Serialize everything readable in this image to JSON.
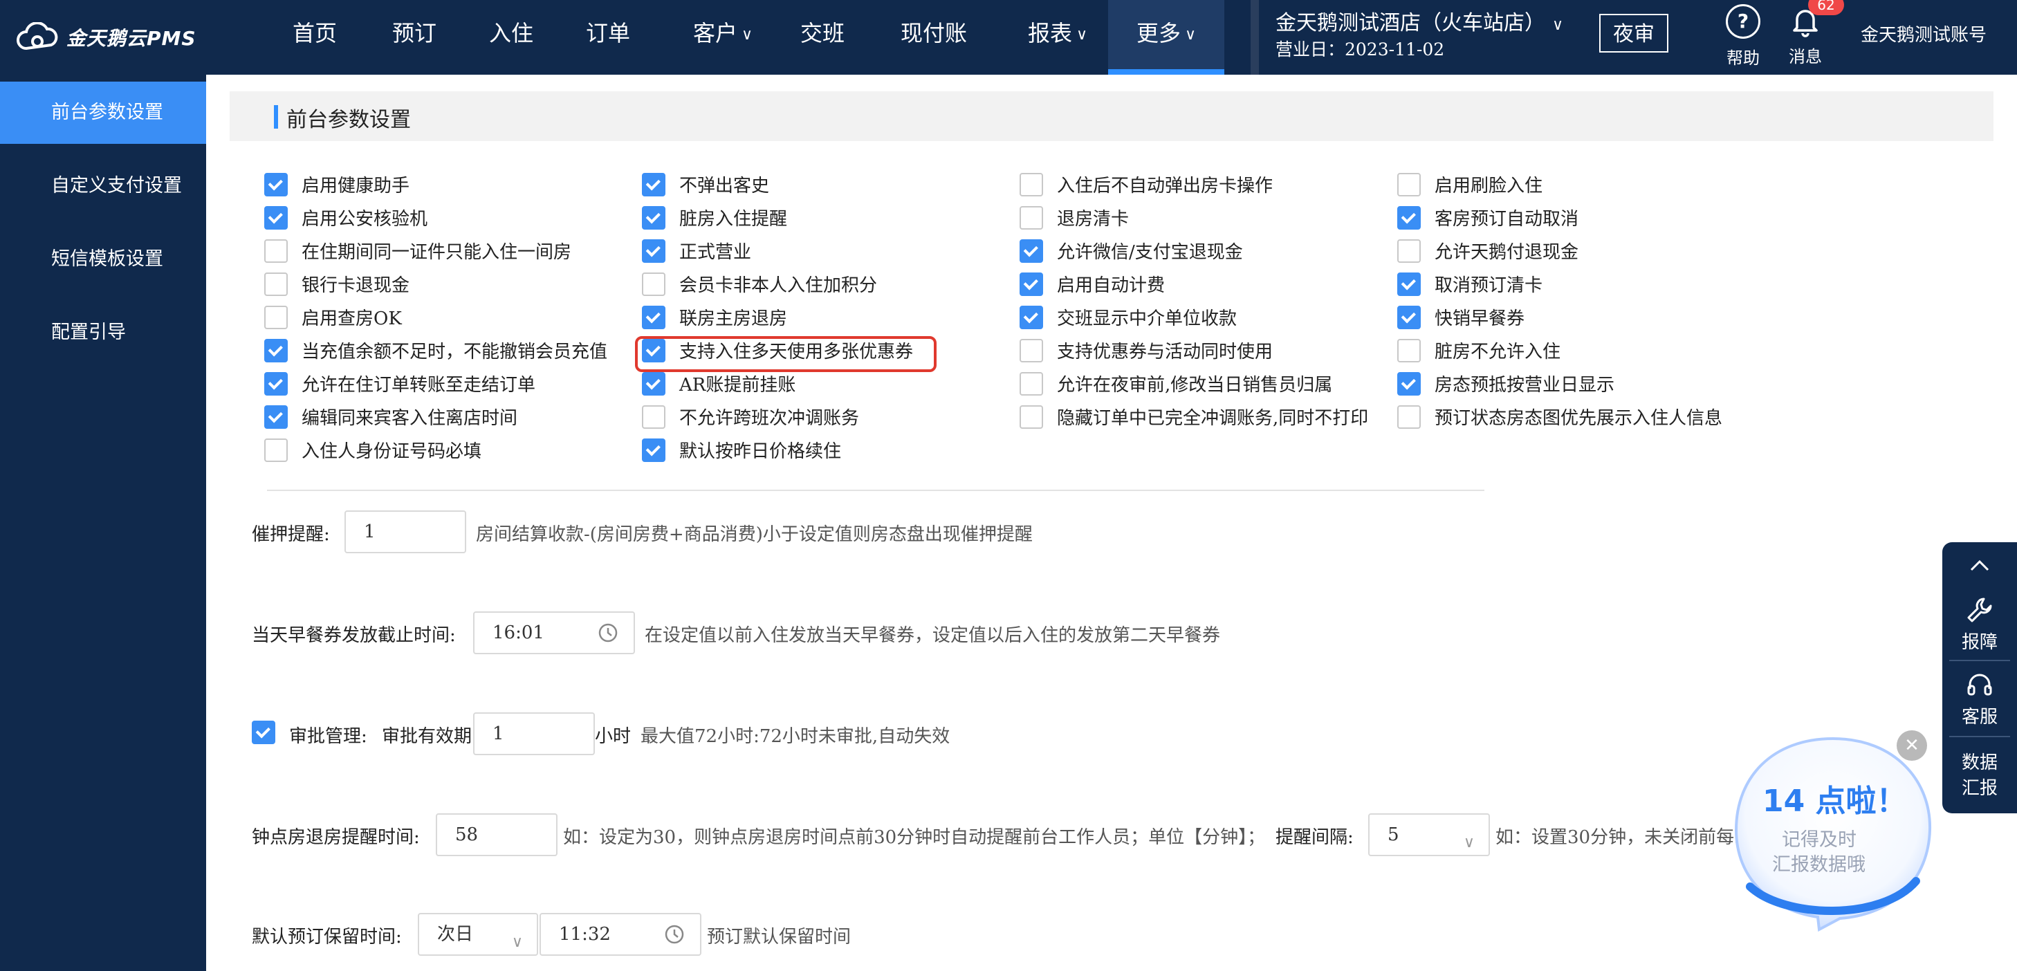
{
  "brand": {
    "name": "金天鹅云PMS"
  },
  "nav": {
    "items": [
      {
        "label": "首页",
        "has_dropdown": false
      },
      {
        "label": "预订",
        "has_dropdown": false
      },
      {
        "label": "入住",
        "has_dropdown": false
      },
      {
        "label": "订单",
        "has_dropdown": false
      },
      {
        "label": "客户",
        "has_dropdown": true
      },
      {
        "label": "交班",
        "has_dropdown": false
      },
      {
        "label": "现付账",
        "has_dropdown": false
      },
      {
        "label": "报表",
        "has_dropdown": true
      },
      {
        "label": "更多",
        "has_dropdown": true,
        "active": true
      }
    ],
    "chevron": "∨"
  },
  "hotel": {
    "name": "金天鹅测试酒店（火车站店）",
    "business_date": "营业日：2023-11-02"
  },
  "header_actions": {
    "night_audit": "夜审",
    "help": "帮助",
    "messages": "消息",
    "message_count": "62",
    "account": "金天鹅测试账号"
  },
  "sidebar": {
    "items": [
      {
        "label": "前台参数设置",
        "active": true
      },
      {
        "label": "自定义支付设置"
      },
      {
        "label": "短信模板设置"
      },
      {
        "label": "配置引导"
      }
    ]
  },
  "section": {
    "title": "前台参数设置"
  },
  "options": {
    "col1": [
      {
        "label": "启用健康助手",
        "checked": true
      },
      {
        "label": "启用公安核验机",
        "checked": true
      },
      {
        "label": "在住期间同一证件只能入住一间房",
        "checked": false
      },
      {
        "label": "银行卡退现金",
        "checked": false
      },
      {
        "label": "启用查房OK",
        "checked": false
      },
      {
        "label": "当充值余额不足时，不能撤销会员充值",
        "checked": true
      },
      {
        "label": "允许在住订单转账至走结订单",
        "checked": true
      },
      {
        "label": "编辑同来宾客入住离店时间",
        "checked": true
      },
      {
        "label": "入住人身份证号码必填",
        "checked": false
      }
    ],
    "col2": [
      {
        "label": "不弹出客史",
        "checked": true
      },
      {
        "label": "脏房入住提醒",
        "checked": true
      },
      {
        "label": "正式营业",
        "checked": true
      },
      {
        "label": "会员卡非本人入住加积分",
        "checked": false
      },
      {
        "label": "联房主房退房",
        "checked": true
      },
      {
        "label": "支持入住多天使用多张优惠券",
        "checked": true
      },
      {
        "label": "AR账提前挂账",
        "checked": true
      },
      {
        "label": "不允许跨班次冲调账务",
        "checked": false
      },
      {
        "label": "默认按昨日价格续住",
        "checked": true
      }
    ],
    "col3": [
      {
        "label": "入住后不自动弹出房卡操作",
        "checked": false
      },
      {
        "label": "退房清卡",
        "checked": false
      },
      {
        "label": "允许微信/支付宝退现金",
        "checked": true
      },
      {
        "label": "启用自动计费",
        "checked": true
      },
      {
        "label": "交班显示中介单位收款",
        "checked": true
      },
      {
        "label": "支持优惠券与活动同时使用",
        "checked": false
      },
      {
        "label": "允许在夜审前,修改当日销售员归属",
        "checked": false
      },
      {
        "label": "隐藏订单中已完全冲调账务,同时不打印",
        "checked": false
      }
    ],
    "col4": [
      {
        "label": "启用刷脸入住",
        "checked": false
      },
      {
        "label": "客房预订自动取消",
        "checked": true
      },
      {
        "label": "允许天鹅付退现金",
        "checked": false
      },
      {
        "label": "取消预订清卡",
        "checked": true
      },
      {
        "label": "快销早餐券",
        "checked": true
      },
      {
        "label": "脏房不允许入住",
        "checked": false
      },
      {
        "label": "房态预抵按营业日显示",
        "checked": true
      },
      {
        "label": "预订状态房态图优先展示入住人信息",
        "checked": false
      }
    ]
  },
  "settings": {
    "deposit_reminder": {
      "label": "催押提醒:",
      "value": "1",
      "desc": "房间结算收款-(房间房费+商品消费)小于设定值则房态盘出现催押提醒"
    },
    "breakfast_cutoff": {
      "label": "当天早餐券发放截止时间:",
      "value": "16:01",
      "desc": "在设定值以前入住发放当天早餐券，设定值以后入住的发放第二天早餐券"
    },
    "approval": {
      "checked": true,
      "label": "审批管理:",
      "sublabel": "审批有效期",
      "value": "1",
      "unit": "小时",
      "desc": "最大值72小时:72小时未审批,自动失效"
    },
    "hourly_room_reminder": {
      "label": "钟点房退房提醒时间:",
      "value": "58",
      "desc": "如：设定为30，则钟点房退房时间点前30分钟时自动提醒前台工作人员；单位【分钟】；",
      "interval_label": "提醒间隔:",
      "interval_value": "5",
      "interval_desc": "如：设置30分钟，未关闭前每30"
    },
    "reservation_hold": {
      "label": "默认预订保留时间:",
      "day_value": "次日",
      "time_value": "11:32",
      "desc": "预订默认保留时间"
    }
  },
  "float_bar": {
    "report": "报障",
    "service": "客服",
    "data_line1": "数据",
    "data_line2": "汇报"
  },
  "promo": {
    "title": "14 点啦！",
    "line1": "记得及时",
    "line2": "汇报数据哦"
  },
  "colors": {
    "nav_bg": "#10294c",
    "accent": "#3a8ef5",
    "highlight": "#e0392e"
  }
}
